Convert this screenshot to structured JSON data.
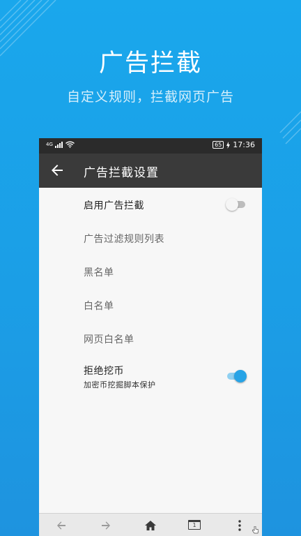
{
  "promo": {
    "headline": "广告拦截",
    "subline": "自定义规则，拦截网页广告"
  },
  "status_bar": {
    "signal_label": "4G",
    "battery_level": "65",
    "time": "17:36"
  },
  "app_bar": {
    "title": "广告拦截设置",
    "back_icon": "arrow-left-icon"
  },
  "settings": {
    "enable_adblock": {
      "label": "启用广告拦截",
      "enabled": false
    },
    "filter_rules": {
      "label": "广告过滤规则列表"
    },
    "blacklist": {
      "label": "黑名单"
    },
    "whitelist": {
      "label": "白名单"
    },
    "page_whitelist": {
      "label": "网页白名单"
    },
    "block_mining": {
      "label": "拒绝挖币",
      "sublabel": "加密币挖掘脚本保护",
      "enabled": true
    }
  },
  "bottom_bar": {
    "tab_count": "1",
    "icons": [
      "back-icon",
      "forward-icon",
      "home-icon",
      "tabs-icon",
      "menu-icon"
    ]
  },
  "colors": {
    "background": "#1aa7ec",
    "toolbar": "#3a3a3a",
    "statusbar": "#2b2b2b",
    "accent": "#26a3e6"
  }
}
